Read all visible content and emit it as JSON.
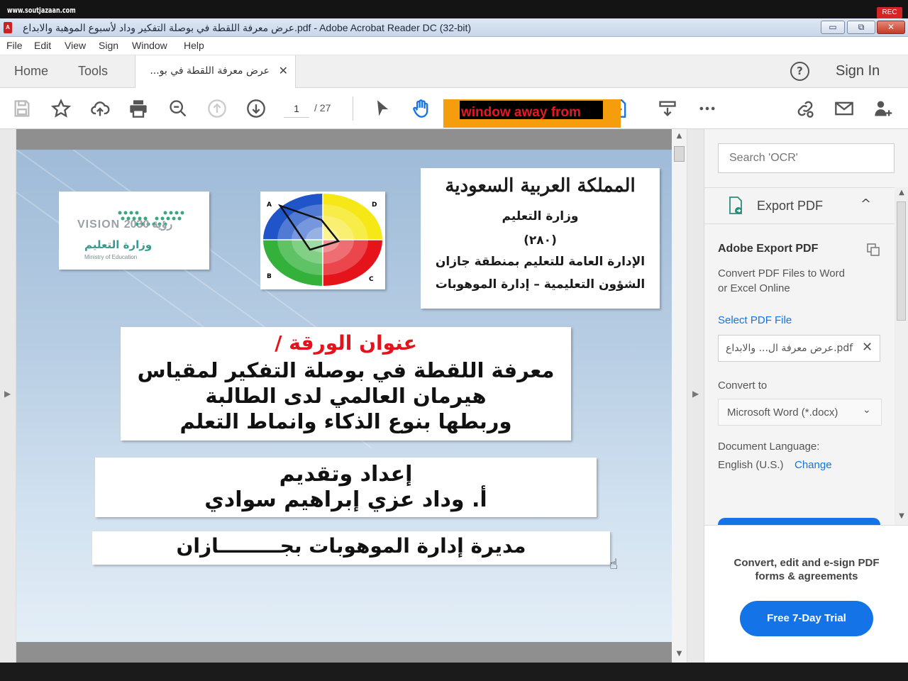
{
  "overlay": {
    "watermark": "www.soutjazaan.com",
    "rec_badge": "REC",
    "capture_text": "window away from"
  },
  "window": {
    "title": "عرض معرفة اللقطة في بوصلة التفكير وداد لأسبوع الموهبة والابداع.pdf - Adobe Acrobat Reader DC (32-bit)",
    "min": "▭",
    "max": "⧉",
    "close": "✕"
  },
  "menu": [
    "File",
    "Edit",
    "View",
    "Sign",
    "Window",
    "Help"
  ],
  "tabs": {
    "home": "Home",
    "tools": "Tools",
    "doc": "عرض معرفة اللقطة في بو...",
    "doc_close": "✕",
    "help": "?",
    "signin": "Sign In"
  },
  "toolbar": {
    "page_current": "1",
    "page_total": "/ 27",
    "icons": [
      "save-icon",
      "bookmark-star-icon",
      "upload-cloud-icon",
      "print-icon",
      "zoom-out-icon",
      "page-up-icon",
      "page-down-icon",
      "select-cursor-icon",
      "hand-tool-icon",
      "create-pdf-icon",
      "stamp-icon",
      "more-icon",
      "link-share-icon",
      "mail-icon",
      "add-user-icon"
    ]
  },
  "slide": {
    "logo_vision": "VISION رؤية 2030",
    "logo_ministry_ar": "وزارة التعليم",
    "logo_ministry_en": "Ministry of Education",
    "radar_labels": {
      "a": "A",
      "b": "B",
      "c": "C",
      "d": "D"
    },
    "radar_colors": {
      "q1": "#f6e716",
      "q2": "#e5131a",
      "q3": "#33b13a",
      "q4": "#1f55c8"
    },
    "ministry": {
      "calligraphy": "المملكة العربية السعودية",
      "line1": "وزارة التعليم",
      "line2": "(٢٨٠)",
      "line3": "الإدارة العامة للتعليم بمنطقة جازان",
      "line4": "الشؤون التعليمية – إدارة الموهوبات"
    },
    "paper_label": "عنوان الورقة  /",
    "title_lines": [
      "معرفة اللقطة في بوصلة التفكير لمقياس",
      "هيرمان العالمي لدى الطالبة",
      "وربطها بنوع الذكاء وانماط التعلم"
    ],
    "author_lines": [
      "إعداد وتقديم",
      "أ. وداد عزي إبراهيم سوادي"
    ],
    "director": "مديرة إدارة الموهوبات بجـــــــــازان"
  },
  "panel": {
    "search_placeholder": "Search 'OCR'",
    "export_label": "Export PDF",
    "export_chevron": "^",
    "title": "Adobe Export PDF",
    "desc_line1": "Convert PDF Files to Word",
    "desc_line2": "or Excel Online",
    "select_link": "Select PDF File",
    "file_name": "عرض معرفة ال... والابداع.pdf",
    "file_remove": "✕",
    "convert_to": "Convert to",
    "format": "Microsoft Word (*.docx)",
    "format_chevron": "⌄",
    "lang_label": "Document Language:",
    "lang_value": "English (U.S.)",
    "lang_change": "Change",
    "promo_line1": "Convert, edit and e-sign PDF",
    "promo_line2": "forms & agreements",
    "trial_button": "Free 7-Day Trial"
  },
  "colors": {
    "accent": "#1473e6",
    "paper_label_red": "#e4121b",
    "acrobat_red": "#d11f1f"
  }
}
